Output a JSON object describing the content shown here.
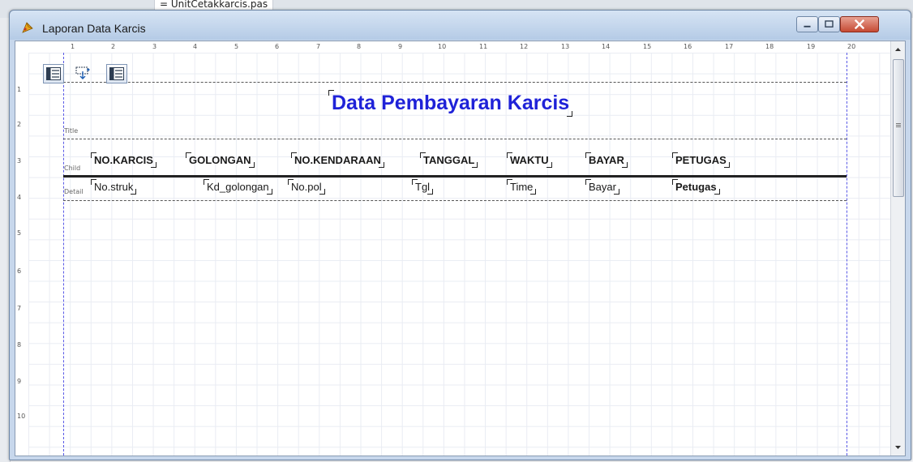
{
  "background": {
    "file_tab": "UnitCetakkarcis.pas",
    "tab_marker": "="
  },
  "window": {
    "title": "Laporan Data Karcis",
    "controls": [
      "minimize",
      "maximize",
      "close"
    ]
  },
  "ruler": {
    "top": [
      "1",
      "2",
      "3",
      "4",
      "5",
      "6",
      "7",
      "8",
      "9",
      "10",
      "11",
      "12",
      "13",
      "14",
      "15",
      "16",
      "17",
      "18",
      "19",
      "20"
    ],
    "left": [
      "1",
      "2",
      "3",
      "4",
      "5",
      "6",
      "7",
      "8",
      "9",
      "10"
    ]
  },
  "toolbar": {
    "icons": [
      "band-icon",
      "align-icon",
      "band-icon"
    ]
  },
  "report": {
    "title": "Data Pembayaran Karcis",
    "bands": {
      "title": "Title",
      "child": "Child",
      "detail": "Detail"
    },
    "columns": [
      {
        "header": "NO.KARCIS",
        "field": "No.struk"
      },
      {
        "header": "GOLONGAN",
        "field": "Kd_golongan"
      },
      {
        "header": "NO.KENDARAAN",
        "field": "No.pol"
      },
      {
        "header": "TANGGAL",
        "field": "Tgl"
      },
      {
        "header": "WAKTU",
        "field": "Time"
      },
      {
        "header": "BAYAR",
        "field": "Bayar"
      },
      {
        "header": "PETUGAS",
        "field": "Petugas"
      }
    ]
  },
  "colors": {
    "title_text": "#1f22d8",
    "margin_line": "#5a5ae6",
    "close_button": "#c64a33"
  }
}
